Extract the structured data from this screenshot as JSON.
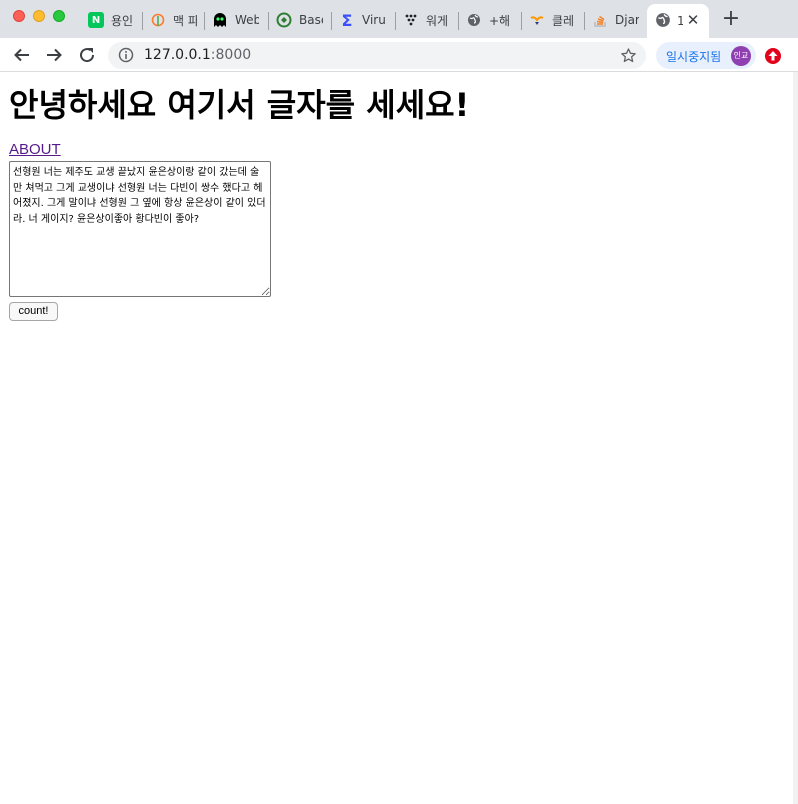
{
  "browser": {
    "tabs": [
      {
        "label": "용인",
        "icon": "naver-icon",
        "color": "#03c75a"
      },
      {
        "label": "맥 파",
        "icon": "blog-icon",
        "color": "#ff7b2c"
      },
      {
        "label": "Web",
        "icon": "ghost-icon",
        "color": "#000000"
      },
      {
        "label": "Base",
        "icon": "recycle-icon",
        "color": "#2e7d32"
      },
      {
        "label": "Viru",
        "icon": "sigma-icon",
        "color": "#394eff"
      },
      {
        "label": "워게",
        "icon": "dots-icon",
        "color": "#202124"
      },
      {
        "label": "+해",
        "icon": "globe-icon",
        "color": "#5f6368"
      },
      {
        "label": "클레",
        "icon": "class-icon",
        "color": "#ff9800"
      },
      {
        "label": "Djar",
        "icon": "stack-icon",
        "color": "#f48024"
      }
    ],
    "active_tab": {
      "label": "1",
      "icon": "globe-icon",
      "close": "✕"
    },
    "new_tab": "+",
    "address": {
      "host": "127.0.0.1",
      "port": ":8000"
    },
    "profile": {
      "status": "일시중지됨",
      "avatar": "인교"
    }
  },
  "page": {
    "heading": "안녕하세요 여기서 글자를 세세요!",
    "about_link": "ABOUT",
    "textarea_value": "선형원 너는 제주도 교생 끝났지 윤은상이랑 같이 갔는데 술만 쳐먹고 그게 교생이냐 선형원 너는 다빈이 쌍수 했다고 헤어졌지. 그게 말이냐 선형원 그 옆에 항상 윤은상이 같이 있더라. 너 게이지? 윤은상이좋아 황다빈이 좋아?",
    "count_button": "count!"
  }
}
